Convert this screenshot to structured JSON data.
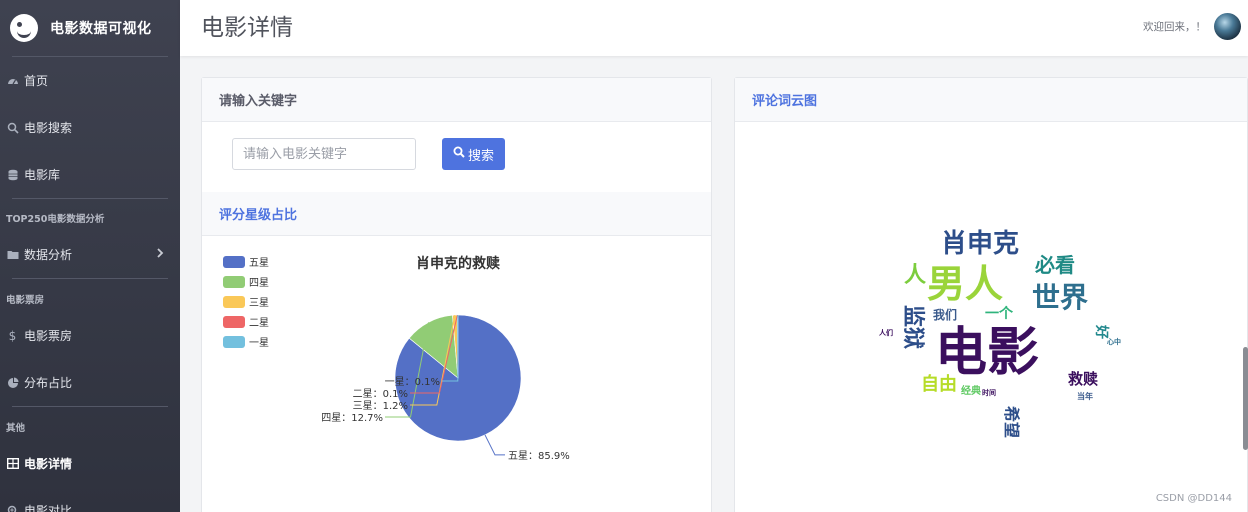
{
  "brand": {
    "title": "电影数据可视化"
  },
  "sidebar": {
    "items_top": [
      {
        "label": "首页",
        "icon": "dashboard-icon"
      },
      {
        "label": "电影搜索",
        "icon": "search-icon"
      },
      {
        "label": "电影库",
        "icon": "database-icon"
      }
    ],
    "section1": "TOP250电影数据分析",
    "analysis": {
      "label": "数据分析",
      "icon": "folder-icon"
    },
    "section2": "电影票房",
    "box_office": [
      {
        "label": "电影票房",
        "icon": "dollar-icon"
      },
      {
        "label": "分布占比",
        "icon": "pie-icon"
      }
    ],
    "section3": "其他",
    "others": [
      {
        "label": "电影详情",
        "icon": "table-icon",
        "active": true
      },
      {
        "label": "电影对比",
        "icon": "search-plus-icon"
      }
    ]
  },
  "header": {
    "page_title": "电影详情",
    "welcome": "欢迎回来，！"
  },
  "search_card": {
    "title": "请输入关键字",
    "placeholder": "请输入电影关键字",
    "button": "搜索",
    "accent": "#4e73df"
  },
  "rating_card": {
    "title": "评分星级占比"
  },
  "wordcloud_card": {
    "title": "评论词云图"
  },
  "chart_data": {
    "type": "pie",
    "title": "肖申克的救赎",
    "legend": [
      "五星",
      "四星",
      "三星",
      "二星",
      "一星"
    ],
    "colors": [
      "#5470c6",
      "#91cc75",
      "#fac858",
      "#ee6666",
      "#73c0de"
    ],
    "values": [
      85.9,
      12.7,
      1.2,
      0.1,
      0.1
    ],
    "labels": [
      "五星：85.9%",
      "四星：12.7%",
      "三星：1.2%",
      "二星：0.1%",
      "一星：0.1%"
    ],
    "legend_position": "top-left"
  },
  "wordcloud": [
    {
      "text": "电影",
      "color": "#3b0f5e"
    },
    {
      "text": "男人",
      "color": "#9ad43a"
    },
    {
      "text": "世界",
      "color": "#2e6f8e"
    },
    {
      "text": "肖申克",
      "color": "#2d4e8a"
    },
    {
      "text": "必看",
      "color": "#1f8a85"
    },
    {
      "text": "人",
      "color": "#7ccd3d"
    },
    {
      "text": "自由",
      "color": "#b6dc28"
    },
    {
      "text": "救赎",
      "color": "#3b0f5e"
    },
    {
      "text": "我们",
      "color": "#3a5a8c"
    },
    {
      "text": "经典",
      "color": "#5ec962"
    },
    {
      "text": "希望",
      "color": "#2d4e8a"
    },
    {
      "text": "监狱",
      "color": "#2d4e8a"
    },
    {
      "text": "一个",
      "color": "#2fb47c"
    },
    {
      "text": "好",
      "color": "#23898e"
    },
    {
      "text": "当年",
      "color": "#3a5a8c"
    },
    {
      "text": "人们",
      "color": "#3b0f5e"
    },
    {
      "text": "心中",
      "color": "#2e6f8e"
    },
    {
      "text": "时间",
      "color": "#3b0f5e"
    }
  ],
  "watermark": "CSDN @DD144"
}
